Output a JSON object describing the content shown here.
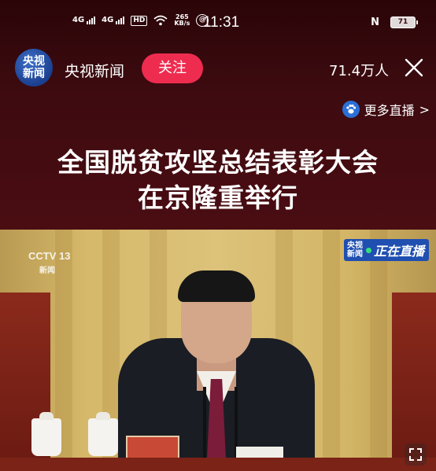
{
  "status_bar": {
    "network1": "4G",
    "network2": "4G",
    "hd": "HD",
    "speed_value": "265",
    "speed_unit": "KB/s",
    "time": "11:31",
    "nfc": "N",
    "battery": "71"
  },
  "channel": {
    "logo_line1": "央视",
    "logo_line2": "新闻",
    "name": "央视新闻",
    "follow_label": "关注",
    "viewers": "71.4万人"
  },
  "more_live": {
    "label": "更多直播",
    "chevron": ">"
  },
  "headline": {
    "line1": "全国脱贫攻坚总结表彰大会",
    "line2": "在京隆重举行"
  },
  "video": {
    "watermark_brand": "CCTV 13",
    "watermark_sub": "新闻",
    "badge_logo1": "央视",
    "badge_logo2": "新闻",
    "badge_text": "正在直播"
  },
  "colors": {
    "follow_button": "#ee2c4f",
    "header_bg": "#3a0a0e",
    "live_badge": "#1f4fb0",
    "live_dot": "#33e07a"
  },
  "icons": [
    "wifi-icon",
    "close-icon",
    "paw-icon",
    "chevron-right-icon",
    "fullscreen-icon"
  ]
}
